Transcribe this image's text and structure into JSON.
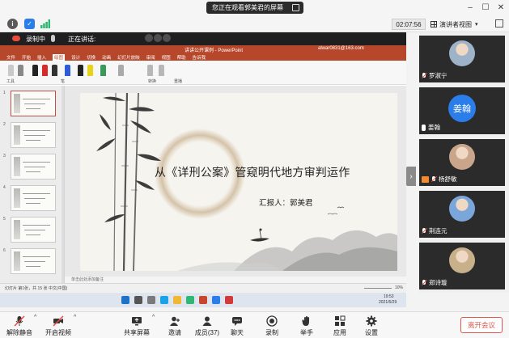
{
  "window": {
    "viewing_banner": "您正在观看郭美君的屏幕",
    "timer": "02:07:56",
    "view_mode": "演讲者视图"
  },
  "recording": {
    "label": "录制中",
    "speaking_label": "正在讲话:"
  },
  "ppt": {
    "doc_title": "讲讲公开课例 - PowerPoint",
    "account": "alwar0831@163.com",
    "menu": [
      "文件",
      "开始",
      "插入",
      "绘图",
      "设计",
      "切换",
      "动画",
      "幻灯片放映",
      "审阅",
      "视图",
      "帮助",
      "告诉我"
    ],
    "active_menu": "绘图",
    "ribbon_labels": [
      "工具",
      "笔",
      "转换",
      "重播"
    ],
    "notes": "单击此处添加备注",
    "status_left": "幻灯片 第1张，共 15 张",
    "status_lang": "中文(中国)",
    "status_zoom": "10%",
    "slide_count": 6,
    "slide_numbers": [
      "1",
      "2",
      "3",
      "4",
      "5",
      "6"
    ]
  },
  "slide": {
    "title": "从《详刑公案》管窥明代地方审判运作",
    "presenter": "汇报人：郭美君"
  },
  "taskbar": {
    "time": "19:53",
    "date": "2021/6/29"
  },
  "participants": [
    {
      "name": "罗淑宁",
      "mic": "off",
      "kind": "photo",
      "color": "#9fb3c8"
    },
    {
      "name": "姜翰",
      "mic": "on",
      "kind": "avatar",
      "initials": "姜翰",
      "color": "#2b7de9"
    },
    {
      "name": "杨舒敏",
      "mic": "off",
      "kind": "photo",
      "color": "#c9a68b",
      "sharing": true
    },
    {
      "name": "荆连元",
      "mic": "off",
      "kind": "photo",
      "color": "#7aa6d9"
    },
    {
      "name": "郑诗璇",
      "mic": "off",
      "kind": "photo",
      "color": "#c7b08a"
    }
  ],
  "toolbar": {
    "unmute": "解除静音",
    "video": "开启视频",
    "share": "共享屏幕",
    "invite": "邀请",
    "members": "成员(37)",
    "chat": "聊天",
    "record": "录制",
    "raise_hand": "举手",
    "apps": "应用",
    "settings": "设置",
    "leave": "离开会议"
  }
}
